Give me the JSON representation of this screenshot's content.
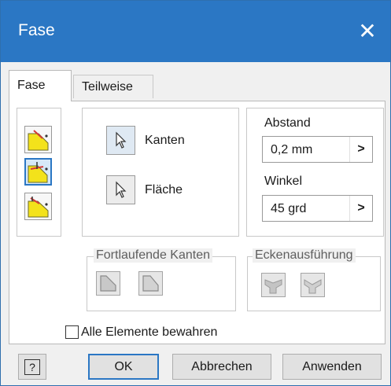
{
  "window": {
    "title": "Fase",
    "close_glyph": "✕"
  },
  "tabs": [
    {
      "label": "Fase",
      "active": true
    },
    {
      "label": "Teilweise",
      "active": false
    }
  ],
  "chamfer_modes": [
    {
      "icon": "chamfer-distance-icon",
      "selected": false
    },
    {
      "icon": "chamfer-distance-angle-icon",
      "selected": true
    },
    {
      "icon": "chamfer-two-distances-icon",
      "selected": false
    }
  ],
  "selection": {
    "edges_label": "Kanten",
    "face_label": "Fläche"
  },
  "distance": {
    "label": "Abstand",
    "value": "0,2 mm"
  },
  "angle": {
    "label": "Winkel",
    "value": "45 grd"
  },
  "chain_edges": {
    "label": "Fortlaufende Kanten"
  },
  "corner_setback": {
    "label": "Eckenausführung"
  },
  "preserve_all": {
    "label": "Alle Elemente bewahren",
    "checked": false
  },
  "buttons": {
    "help_glyph": "?",
    "ok": "OK",
    "cancel": "Abbrechen",
    "apply": "Anwenden"
  },
  "arrow_glyph": ">",
  "colors": {
    "titlebar": "#2b77c4",
    "selected_border": "#2b77c4",
    "icon_yellow": "#f3e21b",
    "icon_red": "#d23a3a"
  }
}
